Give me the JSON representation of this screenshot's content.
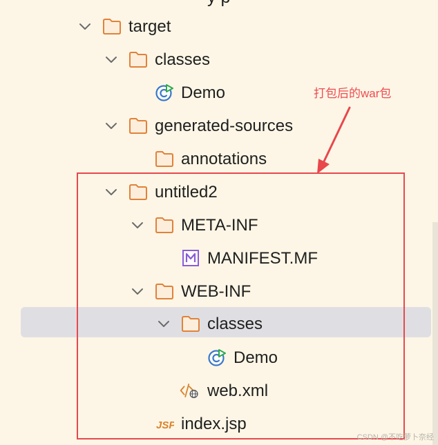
{
  "colors": {
    "background": "#fdf6e6",
    "selection": "#dfdfe3",
    "folder_stroke": "#e0823a",
    "folder_fill": "#fdeedc",
    "annotation_red": "#ee4b52",
    "class_icon_blue": "#3c78c8",
    "class_icon_green": "#2fa84f",
    "manifest_purple": "#8a5cd6",
    "jsp_orange": "#d9822b"
  },
  "top_cut_text": "y p",
  "tree": [
    {
      "label": "target",
      "icon": "folder-icon",
      "expanded": true
    },
    {
      "label": "classes",
      "icon": "folder-icon",
      "expanded": true
    },
    {
      "label": "Demo",
      "icon": "java-class-icon"
    },
    {
      "label": "generated-sources",
      "icon": "folder-icon",
      "expanded": true
    },
    {
      "label": "annotations",
      "icon": "folder-icon"
    },
    {
      "label": "untitled2",
      "icon": "folder-icon",
      "expanded": true
    },
    {
      "label": "META-INF",
      "icon": "folder-icon",
      "expanded": true
    },
    {
      "label": "MANIFEST.MF",
      "icon": "manifest-icon"
    },
    {
      "label": "WEB-INF",
      "icon": "folder-icon",
      "expanded": true
    },
    {
      "label": "classes",
      "icon": "folder-icon",
      "expanded": true,
      "selected": true
    },
    {
      "label": "Demo",
      "icon": "java-class-icon"
    },
    {
      "label": "web.xml",
      "icon": "web-xml-icon"
    },
    {
      "label": "index.jsp",
      "icon": "jsp-icon"
    }
  ],
  "annotation": {
    "text": "打包后的war包"
  },
  "watermark": "CSDN @不吃萝卜奈经"
}
